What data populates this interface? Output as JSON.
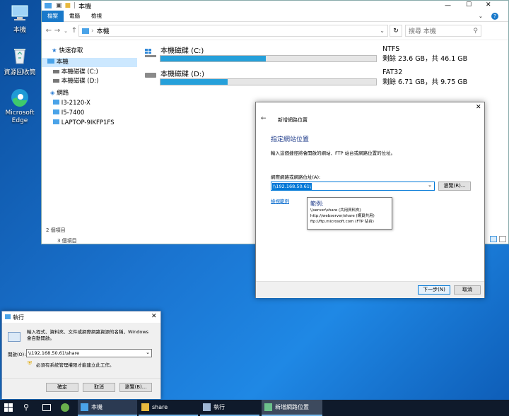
{
  "desktop": {
    "icons": [
      {
        "label": "本機",
        "icon": "computer-icon"
      },
      {
        "label": "資源回收筒",
        "icon": "recycle-bin-icon"
      },
      {
        "label": "Microsoft Edge",
        "icon": "edge-icon"
      }
    ]
  },
  "explorer": {
    "title": "本機",
    "ribbon_tabs": [
      "檔案",
      "電腦",
      "檢視"
    ],
    "address": "本機",
    "search_placeholder": "搜尋 本機",
    "nav": {
      "quick_access": "快速存取",
      "this_pc": "本機",
      "drive_c": "本機磁碟 (C:)",
      "drive_d": "本機磁碟 (D:)",
      "network": "網路",
      "hosts": [
        "I3-2120-X",
        "I5-7400",
        "LAPTOP-9IKFP1FS"
      ]
    },
    "drives": [
      {
        "name": "本機磁碟 (C:)",
        "fs": "NTFS",
        "space": "剩餘 23.6 GB，共 46.1 GB",
        "used_fraction": 0.49
      },
      {
        "name": "本機磁碟 (D:)",
        "fs": "FAT32",
        "space": "剩餘 6.71 GB，共 9.75 GB",
        "used_fraction": 0.31
      }
    ],
    "status_items": "2 個項目",
    "status_items_back": "3 個項目",
    "colors": {
      "bar_fill": "#26a0da",
      "ribbon_file": "#1979ca"
    }
  },
  "wizard": {
    "title": "新增網路位置",
    "heading": "指定網站位置",
    "instruction": "輸入這個捷徑將會開啟的網站、FTP 站台或網路位置的位址。",
    "field_label": "網際網路或網路位址(A):",
    "field_value": "\\\\192.168.50.61\\",
    "browse": "瀏覽(R)...",
    "examples_link": "檢視範例",
    "tooltip": {
      "title": "範例:",
      "lines": [
        "\\\\server\\share  (共用資料夾)",
        "http://webserver/share  (網頁共用)",
        "ftp://ftp.microsoft.com  (FTP 站台)"
      ]
    },
    "next": "下一步(N)",
    "cancel": "取消"
  },
  "run": {
    "title": "執行",
    "description": "輸入程式、資料夾、文件或網際網路資源的名稱，Windows 會自動開啟。",
    "open_label": "開啟(O):",
    "open_value": "\\\\192.168.50.61\\share",
    "admin_note": "必須有系統管理權限才能建立此工作。",
    "ok": "確定",
    "cancel": "取消",
    "browse": "瀏覽(B)..."
  },
  "taskbar": {
    "apps": [
      {
        "label": "本機",
        "icon": "explorer-icon"
      },
      {
        "label": "share",
        "icon": "folder-icon"
      },
      {
        "label": "執行",
        "icon": "run-icon"
      },
      {
        "label": "新增網路位置",
        "icon": "network-location-icon"
      }
    ]
  }
}
